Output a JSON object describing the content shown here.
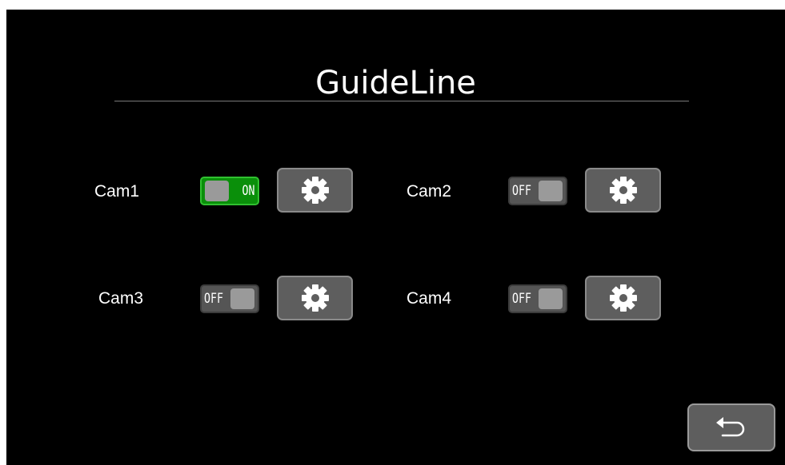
{
  "title": "GuideLine",
  "cameras": [
    {
      "label": "Cam1",
      "state": "ON",
      "enabled": true,
      "settings_icon": "gear-icon"
    },
    {
      "label": "Cam2",
      "state": "OFF",
      "enabled": false,
      "settings_icon": "gear-icon"
    },
    {
      "label": "Cam3",
      "state": "OFF",
      "enabled": false,
      "settings_icon": "gear-icon"
    },
    {
      "label": "Cam4",
      "state": "OFF",
      "enabled": false,
      "settings_icon": "gear-icon"
    }
  ],
  "back_icon": "back-arrow-icon",
  "colors": {
    "background": "#000000",
    "toggle_on": "#0a8f0a",
    "toggle_off": "#555555",
    "button": "#5e5e5e"
  }
}
